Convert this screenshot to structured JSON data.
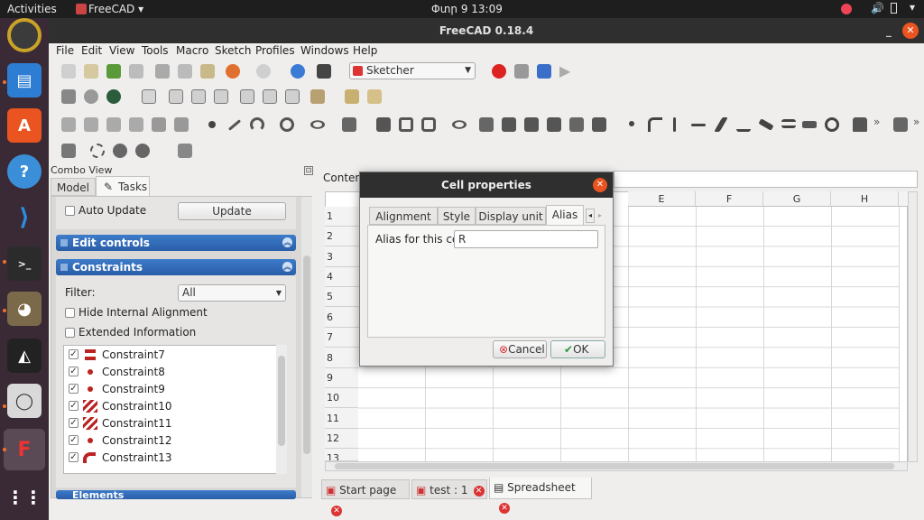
{
  "topbar": {
    "activities": "Activities",
    "app": "FreeCAD ▾",
    "clock": "Փտր 9  13:09"
  },
  "window": {
    "title": "FreeCAD 0.18.4"
  },
  "menu": [
    "File",
    "Edit",
    "View",
    "Tools",
    "Macro",
    "Sketch",
    "Profiles",
    "Windows",
    "Help"
  ],
  "workbench": "Sketcher",
  "combo": {
    "title": "Combo View",
    "tab_model": "Model",
    "tab_tasks": "Tasks",
    "auto_update": "Auto Update",
    "update": "Update",
    "edit_controls": "Edit controls",
    "constraints": "Constraints",
    "filter_label": "Filter:",
    "filter_value": "All",
    "hide_internal": "Hide Internal Alignment",
    "extended_info": "Extended Information",
    "elements": "Elements"
  },
  "constraints_list": [
    "Constraint7",
    "Constraint8",
    "Constraint9",
    "Constraint10",
    "Constraint11",
    "Constraint12",
    "Constraint13"
  ],
  "sheet": {
    "content_label": "Content",
    "columns": [
      "E",
      "F",
      "G",
      "H"
    ],
    "rows": [
      "1",
      "2",
      "3",
      "4",
      "5",
      "6",
      "7",
      "8",
      "9",
      "10",
      "11",
      "12",
      "13"
    ]
  },
  "dialog": {
    "title": "Cell properties",
    "tabs": [
      "Alignment",
      "Style",
      "Display unit",
      "Alias"
    ],
    "alias_label": "Alias for this cell",
    "alias_value": "R",
    "cancel": "Cancel",
    "ok": "OK"
  },
  "bottom_tabs": [
    "Start page",
    "test : 1",
    "Spreadsheet"
  ]
}
